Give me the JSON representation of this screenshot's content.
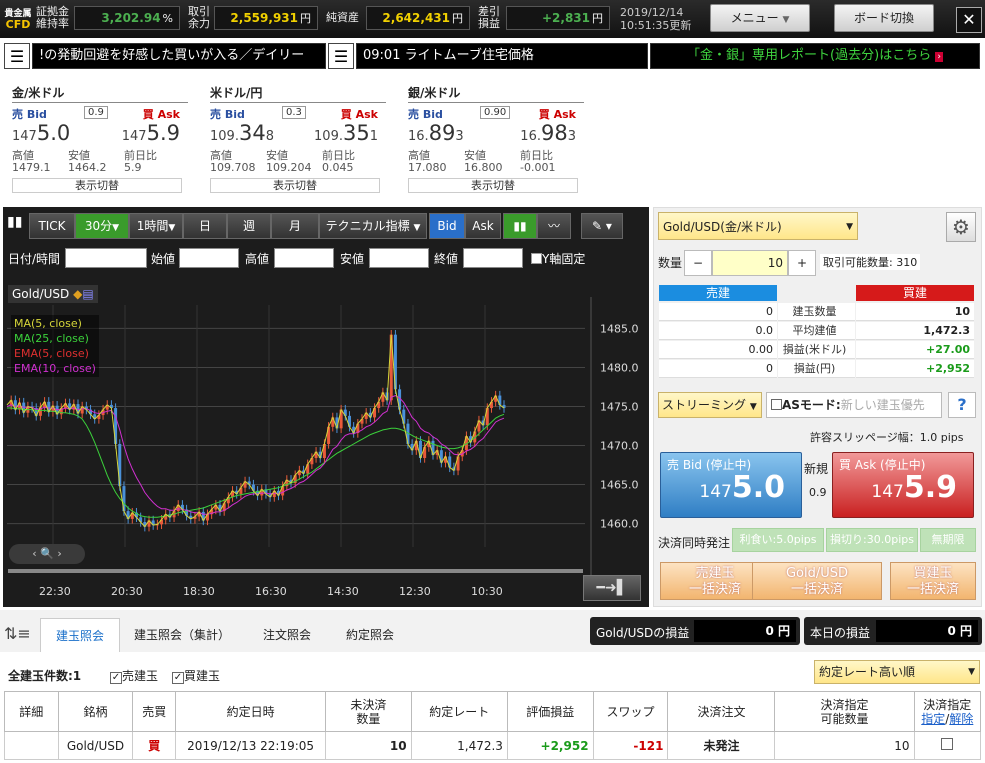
{
  "topbar": {
    "logo_line1": "貴金属",
    "logo_line2": "CFD",
    "margin_label1": "証拠金",
    "margin_label2": "維持率",
    "margin_value": "3,202.94",
    "margin_unit": "%",
    "power_label1": "取引",
    "power_label2": "余力",
    "power_value": "2,559,931",
    "power_unit": "円",
    "nav_label": "純資産",
    "nav_value": "2,642,431",
    "nav_unit": "円",
    "pl_label1": "差引",
    "pl_label2": "損益",
    "pl_value": "+2,831",
    "pl_unit": "円",
    "date": "2019/12/14",
    "time": "10:51:35更新",
    "menu_label": "メニュー",
    "board_label": "ボード切換",
    "close": "✕"
  },
  "ticker": {
    "news1": "!の発動回避を好感した買いが入る／デイリー",
    "news2": "09:01 ライトムーブ住宅価格",
    "banner": "「金・銀」専用レポート(過去分)はこちら"
  },
  "rates": [
    {
      "name": "金/米ドル",
      "bid_label": "売 Bid",
      "ask_label": "買 Ask",
      "spread": "0.9",
      "bid_pre": "147",
      "bid_big": "5.0",
      "bid_post": "",
      "ask_pre": "147",
      "ask_big": "5.9",
      "ask_post": "",
      "high_label": "高値",
      "low_label": "安値",
      "chg_label": "前日比",
      "high": "1479.1",
      "low": "1464.2",
      "chg": "5.9",
      "switch": "表示切替"
    },
    {
      "name": "米ドル/円",
      "bid_label": "売 Bid",
      "ask_label": "買 Ask",
      "spread": "0.3",
      "bid_pre": "109.",
      "bid_big": "34",
      "bid_post": "8",
      "ask_pre": "109.",
      "ask_big": "35",
      "ask_post": "1",
      "high_label": "高値",
      "low_label": "安値",
      "chg_label": "前日比",
      "high": "109.708",
      "low": "109.204",
      "chg": "0.045",
      "switch": "表示切替"
    },
    {
      "name": "銀/米ドル",
      "bid_label": "売 Bid",
      "ask_label": "買 Ask",
      "spread": "0.90",
      "bid_pre": "16.",
      "bid_big": "89",
      "bid_post": "3",
      "ask_pre": "16.",
      "ask_big": "98",
      "ask_post": "3",
      "high_label": "高値",
      "low_label": "安値",
      "chg_label": "前日比",
      "high": "17.080",
      "low": "16.800",
      "chg": "-0.001",
      "switch": "表示切替"
    }
  ],
  "chart_toolbar": {
    "tick": "TICK",
    "m30": "30分",
    "h1": "1時間",
    "day": "日",
    "week": "週",
    "month": "月",
    "tech": "テクニカル指標",
    "bid": "Bid",
    "ask": "Ask"
  },
  "chart_fields": {
    "datetime": "日付/時間",
    "open": "始値",
    "high": "高値",
    "low": "安値",
    "close": "終値",
    "yfix": "Y軸固定"
  },
  "chart_symbol": "Gold/USD",
  "chart_data": {
    "type": "line",
    "legend": [
      "MA(5, close)",
      "MA(25, close)",
      "EMA(5, close)",
      "EMA(10, close)"
    ],
    "legend_colors": [
      "#d6d63a",
      "#3bd13b",
      "#e03030",
      "#d030d0"
    ],
    "y_ticks": [
      "1485.0",
      "1480.0",
      "1475.0",
      "1470.0",
      "1465.0",
      "1460.0"
    ],
    "x_ticks": [
      "22:30",
      "20:30",
      "18:30",
      "16:30",
      "14:30",
      "12:30",
      "10:30"
    ],
    "ylim": [
      1457,
      1488
    ],
    "x": [
      0,
      4,
      8,
      12,
      16,
      20,
      24,
      28,
      32,
      36,
      40,
      44,
      48,
      52,
      56,
      60,
      64,
      68,
      72,
      76,
      80,
      84,
      88,
      92,
      96,
      100,
      104,
      108,
      112,
      116,
      120,
      124,
      128,
      132,
      136,
      140,
      144,
      148,
      152,
      156,
      160,
      164,
      168,
      172,
      176,
      180,
      184,
      188,
      192,
      196,
      200,
      204,
      208,
      212,
      216,
      220,
      224,
      228,
      232,
      236,
      240,
      244,
      248,
      252,
      256,
      260,
      264,
      268,
      272,
      276,
      280,
      284,
      288,
      292,
      296,
      300,
      304,
      308,
      312,
      316,
      320,
      324,
      328,
      332,
      336,
      340,
      344,
      348,
      352,
      356,
      360,
      364,
      368,
      372,
      376,
      380,
      384,
      388,
      392,
      396,
      400,
      404,
      408,
      412,
      416,
      420,
      424,
      428,
      432,
      436,
      440,
      444,
      448,
      452,
      456,
      460,
      464,
      468,
      472,
      476,
      480,
      484,
      488,
      492,
      496,
      500,
      504,
      508,
      512,
      516,
      520,
      524,
      528,
      532,
      536,
      540,
      544
    ],
    "close": [
      1475.2,
      1475.8,
      1474.6,
      1475.5,
      1474.2,
      1475.0,
      1474.8,
      1473.8,
      1474.9,
      1475.6,
      1474.3,
      1475.1,
      1474.0,
      1474.8,
      1475.4,
      1474.6,
      1475.3,
      1474.1,
      1475.0,
      1474.6,
      1474.0,
      1473.4,
      1473.9,
      1474.6,
      1475.2,
      1474.8,
      1470.2,
      1464.8,
      1461.6,
      1460.6,
      1461.4,
      1460.8,
      1460.2,
      1459.6,
      1460.4,
      1459.8,
      1459.9,
      1460.5,
      1461.2,
      1460.8,
      1461.6,
      1462.4,
      1461.8,
      1461.0,
      1460.6,
      1460.9,
      1461.5,
      1460.4,
      1461.2,
      1461.8,
      1462.4,
      1461.6,
      1462.6,
      1463.4,
      1464.2,
      1463.8,
      1464.6,
      1465.4,
      1465.0,
      1464.2,
      1463.6,
      1464.4,
      1463.8,
      1463.4,
      1464.2,
      1463.6,
      1464.8,
      1465.6,
      1465.2,
      1466.2,
      1466.8,
      1466.4,
      1467.6,
      1468.4,
      1469.2,
      1468.4,
      1470.2,
      1472.4,
      1473.6,
      1472.2,
      1474.6,
      1473.8,
      1472.4,
      1471.6,
      1472.8,
      1473.4,
      1474.2,
      1473.6,
      1474.8,
      1475.6,
      1476.8,
      1475.8,
      1484.2,
      1477.2,
      1474.6,
      1472.8,
      1470.2,
      1469.4,
      1470.6,
      1468.4,
      1469.8,
      1470.6,
      1468.8,
      1469.4,
      1467.8,
      1468.6,
      1467.2,
      1466.8,
      1468.6,
      1469.4,
      1471.2,
      1470.4,
      1471.8,
      1473.2,
      1472.6,
      1474.8,
      1475.6,
      1476.4,
      1475.2,
      1474.8
    ],
    "ma25": [
      1474.8,
      1474.8,
      1474.7,
      1474.7,
      1474.6,
      1474.6,
      1474.6,
      1474.5,
      1474.5,
      1474.5,
      1474.4,
      1474.4,
      1474.3,
      1474.2,
      1474.2,
      1474.1,
      1474.0,
      1473.8,
      1473.4,
      1472.6,
      1471.6,
      1470.4,
      1469.0,
      1467.6,
      1466.2,
      1465.0,
      1464.0,
      1463.2,
      1462.6,
      1462.0,
      1461.6,
      1461.3,
      1461.0,
      1460.9,
      1460.8,
      1460.8,
      1460.8,
      1460.9,
      1461.0,
      1461.1,
      1461.2,
      1461.4,
      1461.5,
      1461.6,
      1461.7,
      1461.8,
      1461.9,
      1462.0,
      1462.2,
      1462.4,
      1462.6,
      1462.8,
      1463.0,
      1463.2,
      1463.4,
      1463.6,
      1463.7,
      1463.8,
      1463.9,
      1464.0,
      1464.1,
      1464.2,
      1464.3,
      1464.4,
      1464.5,
      1464.6,
      1464.8,
      1465.0,
      1465.2,
      1465.4,
      1465.7,
      1466.0,
      1466.3,
      1466.6,
      1467.0,
      1467.4,
      1467.8,
      1468.2,
      1468.6,
      1469.0,
      1469.3,
      1469.6,
      1469.9,
      1470.2,
      1470.5,
      1470.8,
      1471.1,
      1471.4,
      1471.6,
      1471.8,
      1472.0,
      1472.1,
      1472.2,
      1472.2,
      1472.1,
      1471.9,
      1471.6,
      1471.3,
      1471.0,
      1470.8,
      1470.6,
      1470.4,
      1470.2,
      1470.0,
      1469.8,
      1469.7,
      1469.6,
      1469.6,
      1469.7,
      1469.9,
      1470.2,
      1470.6,
      1471.0,
      1471.5,
      1472.0,
      1472.5,
      1473.0,
      1473.5,
      1473.8,
      1474.0
    ],
    "ema10": [
      1475.0,
      1475.2,
      1475.0,
      1475.1,
      1474.9,
      1474.9,
      1474.9,
      1474.6,
      1474.7,
      1474.9,
      1474.8,
      1474.8,
      1474.6,
      1474.6,
      1474.8,
      1474.7,
      1474.8,
      1474.6,
      1474.7,
      1474.7,
      1474.5,
      1474.2,
      1474.1,
      1474.2,
      1474.4,
      1474.5,
      1473.7,
      1472.0,
      1470.0,
      1468.3,
      1467.0,
      1465.9,
      1465.0,
      1464.0,
      1463.3,
      1462.7,
      1462.2,
      1461.9,
      1461.9,
      1461.7,
      1461.7,
      1461.9,
      1461.8,
      1461.7,
      1461.5,
      1461.4,
      1461.4,
      1461.2,
      1461.2,
      1461.3,
      1461.5,
      1461.5,
      1461.7,
      1462.0,
      1462.4,
      1462.7,
      1463.1,
      1463.5,
      1463.7,
      1463.8,
      1463.8,
      1463.9,
      1463.9,
      1463.8,
      1463.9,
      1463.8,
      1464.0,
      1464.3,
      1464.5,
      1464.8,
      1465.2,
      1465.4,
      1465.8,
      1466.3,
      1466.8,
      1467.1,
      1467.7,
      1468.6,
      1469.5,
      1469.9,
      1470.7,
      1471.3,
      1471.5,
      1471.5,
      1471.7,
      1472.0,
      1472.4,
      1472.6,
      1473.0,
      1473.5,
      1474.1,
      1474.4,
      1476.2,
      1476.4,
      1476.1,
      1475.5,
      1474.6,
      1473.6,
      1473.1,
      1472.2,
      1471.8,
      1471.6,
      1471.1,
      1470.8,
      1470.2,
      1469.9,
      1469.4,
      1468.9,
      1468.8,
      1468.9,
      1469.3,
      1469.5,
      1469.9,
      1470.5,
      1470.9,
      1471.6,
      1472.3,
      1473.0,
      1473.3,
      1473.5
    ]
  },
  "order": {
    "symbol": "Gold/USD(金/米ドル)",
    "qty_label": "数量",
    "qty_minus": "−",
    "qty_value": "10",
    "qty_plus": "+",
    "avail": "取引可能数量: 310",
    "sell_head": "売建",
    "buy_head": "買建",
    "rows": [
      {
        "sell": "0",
        "label": "建玉数量",
        "buy": "10"
      },
      {
        "sell": "0.0",
        "label": "平均建値",
        "buy": "1,472.3"
      },
      {
        "sell": "0.00",
        "label": "損益(米ドル)",
        "buy": "+27.00"
      },
      {
        "sell": "0",
        "label": "損益(円)",
        "buy": "+2,952"
      }
    ],
    "mode": "ストリーミング",
    "as_mode": "ASモード:",
    "as_placeholder": "新しい建玉優先",
    "help": "?",
    "slippage": "許容スリッページ幅：1.0 pips",
    "sell_label": "売 Bid (停止中)",
    "sell_pre": "147",
    "sell_big": "5.0",
    "new_label": "新規",
    "spread": "0.9",
    "buy_label": "買 Ask (停止中)",
    "buy_pre": "147",
    "buy_big": "5.9",
    "settle_label": "決済同時発注",
    "tp": "利食い:5.0pips",
    "sl": "損切り:30.0pips",
    "unlimited": "無期限",
    "btn1a": "売建玉",
    "btn1b": "一括決済",
    "btn2a": "Gold/USD",
    "btn2b": "一括決済",
    "btn3a": "買建玉",
    "btn3b": "一括決済"
  },
  "bottom": {
    "tabs": [
      "建玉照会",
      "建玉照会（集計）",
      "注文照会",
      "約定照会"
    ],
    "sym_pl_label": "Gold/USDの損益",
    "sym_pl_value": "0 円",
    "day_pl_label": "本日の損益",
    "day_pl_value": "0 円",
    "count_label": "全建玉件数:1",
    "chk_sell": "売建玉",
    "chk_buy": "買建玉",
    "sort": "約定レート高い順",
    "headers": [
      "詳細",
      "銘柄",
      "売買",
      "約定日時",
      "未決済\n数量",
      "約定レート",
      "評価損益",
      "スワップ",
      "決済注文",
      "決済指定\n可能数量",
      "決済指定"
    ],
    "hdr_link1": "指定",
    "hdr_slash": "/",
    "hdr_link2": "解除",
    "row": {
      "detail": "",
      "symbol": "Gold/USD",
      "side": "買",
      "datetime": "2019/12/13 22:19:05",
      "qty": "10",
      "rate": "1,472.3",
      "pl": "+2,952",
      "swap": "-121",
      "order": "未発注",
      "avail": "10"
    }
  }
}
